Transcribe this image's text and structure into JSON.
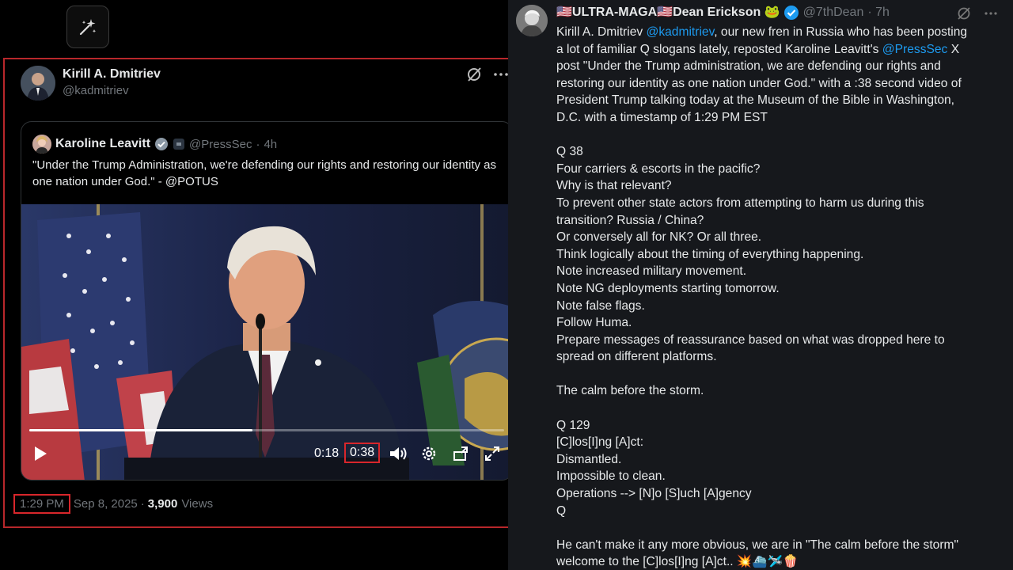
{
  "icons": {
    "sparkle": "sparkle-icon",
    "grok": "grok-icon",
    "more": "more-icon",
    "verified": "verified-badge-icon"
  },
  "colors": {
    "accent": "#1d9bf0",
    "highlight": "#d8262b",
    "verified": "#1d9bf0"
  },
  "left_post": {
    "author_name": "Kirill A. Dmitriev",
    "author_handle": "@kadmitriev",
    "quoted": {
      "name": "Karoline Leavitt",
      "handle": "@PressSec",
      "age": "4h",
      "text": "\"Under the Trump Administration, we're defending our rights and restoring our identity as one nation under God.\" - @POTUS"
    },
    "video": {
      "current_time": "0:18",
      "duration": "0:38",
      "progress_fraction": 0.47
    },
    "time": "1:29 PM",
    "date": "Sep 8, 2025",
    "separator": "·",
    "views_count": "3,900",
    "views_label": "Views"
  },
  "right_post": {
    "author_name": "🇺🇸ULTRA-MAGA🇺🇸Dean Erickson 🐸",
    "author_handle": "@7thDean",
    "age": "· 7h",
    "lines": [
      [
        "Kirill A. Dmitriev ",
        {
          "m": "@kadmitriev"
        },
        ", our new fren in Russia who has been posting"
      ],
      [
        "a lot of familiar Q slogans lately, reposted Karoline Leavitt's ",
        {
          "m": "@PressSec"
        },
        "  X"
      ],
      [
        "post \"Under the Trump administration, we are defending our rights and"
      ],
      [
        "restoring our identity as one nation under God.\" with a :38 second video of"
      ],
      [
        "President Trump talking today at the Museum of the Bible in Washington,"
      ],
      [
        "D.C. with a timestamp of 1:29 PM EST"
      ],
      [
        ""
      ],
      [
        "Q 38"
      ],
      [
        "Four carriers & escorts in the pacific?"
      ],
      [
        "Why is that relevant?"
      ],
      [
        "To prevent other state actors from attempting to harm us during this"
      ],
      [
        "transition? Russia / China?"
      ],
      [
        "Or conversely all for NK? Or all three."
      ],
      [
        "Think logically about the timing of everything happening."
      ],
      [
        "Note increased military movement."
      ],
      [
        "Note NG deployments starting tomorrow."
      ],
      [
        "Note false flags."
      ],
      [
        "Follow Huma."
      ],
      [
        "Prepare messages of reassurance based on what was dropped here to"
      ],
      [
        "spread on different platforms."
      ],
      [
        ""
      ],
      [
        "The calm before the storm."
      ],
      [
        ""
      ],
      [
        "Q 129"
      ],
      [
        "[C]los[I]ng [A]ct:"
      ],
      [
        "Dismantled."
      ],
      [
        "Impossible to clean."
      ],
      [
        "Operations --> [N]o [S]uch [A]gency"
      ],
      [
        "Q"
      ],
      [
        ""
      ],
      [
        "He can't make it any more obvious, we are in \"The calm before the storm\""
      ],
      [
        "welcome to the [C]los[I]ng [A]ct.. 💥⛴️🛩️🍿"
      ]
    ]
  }
}
